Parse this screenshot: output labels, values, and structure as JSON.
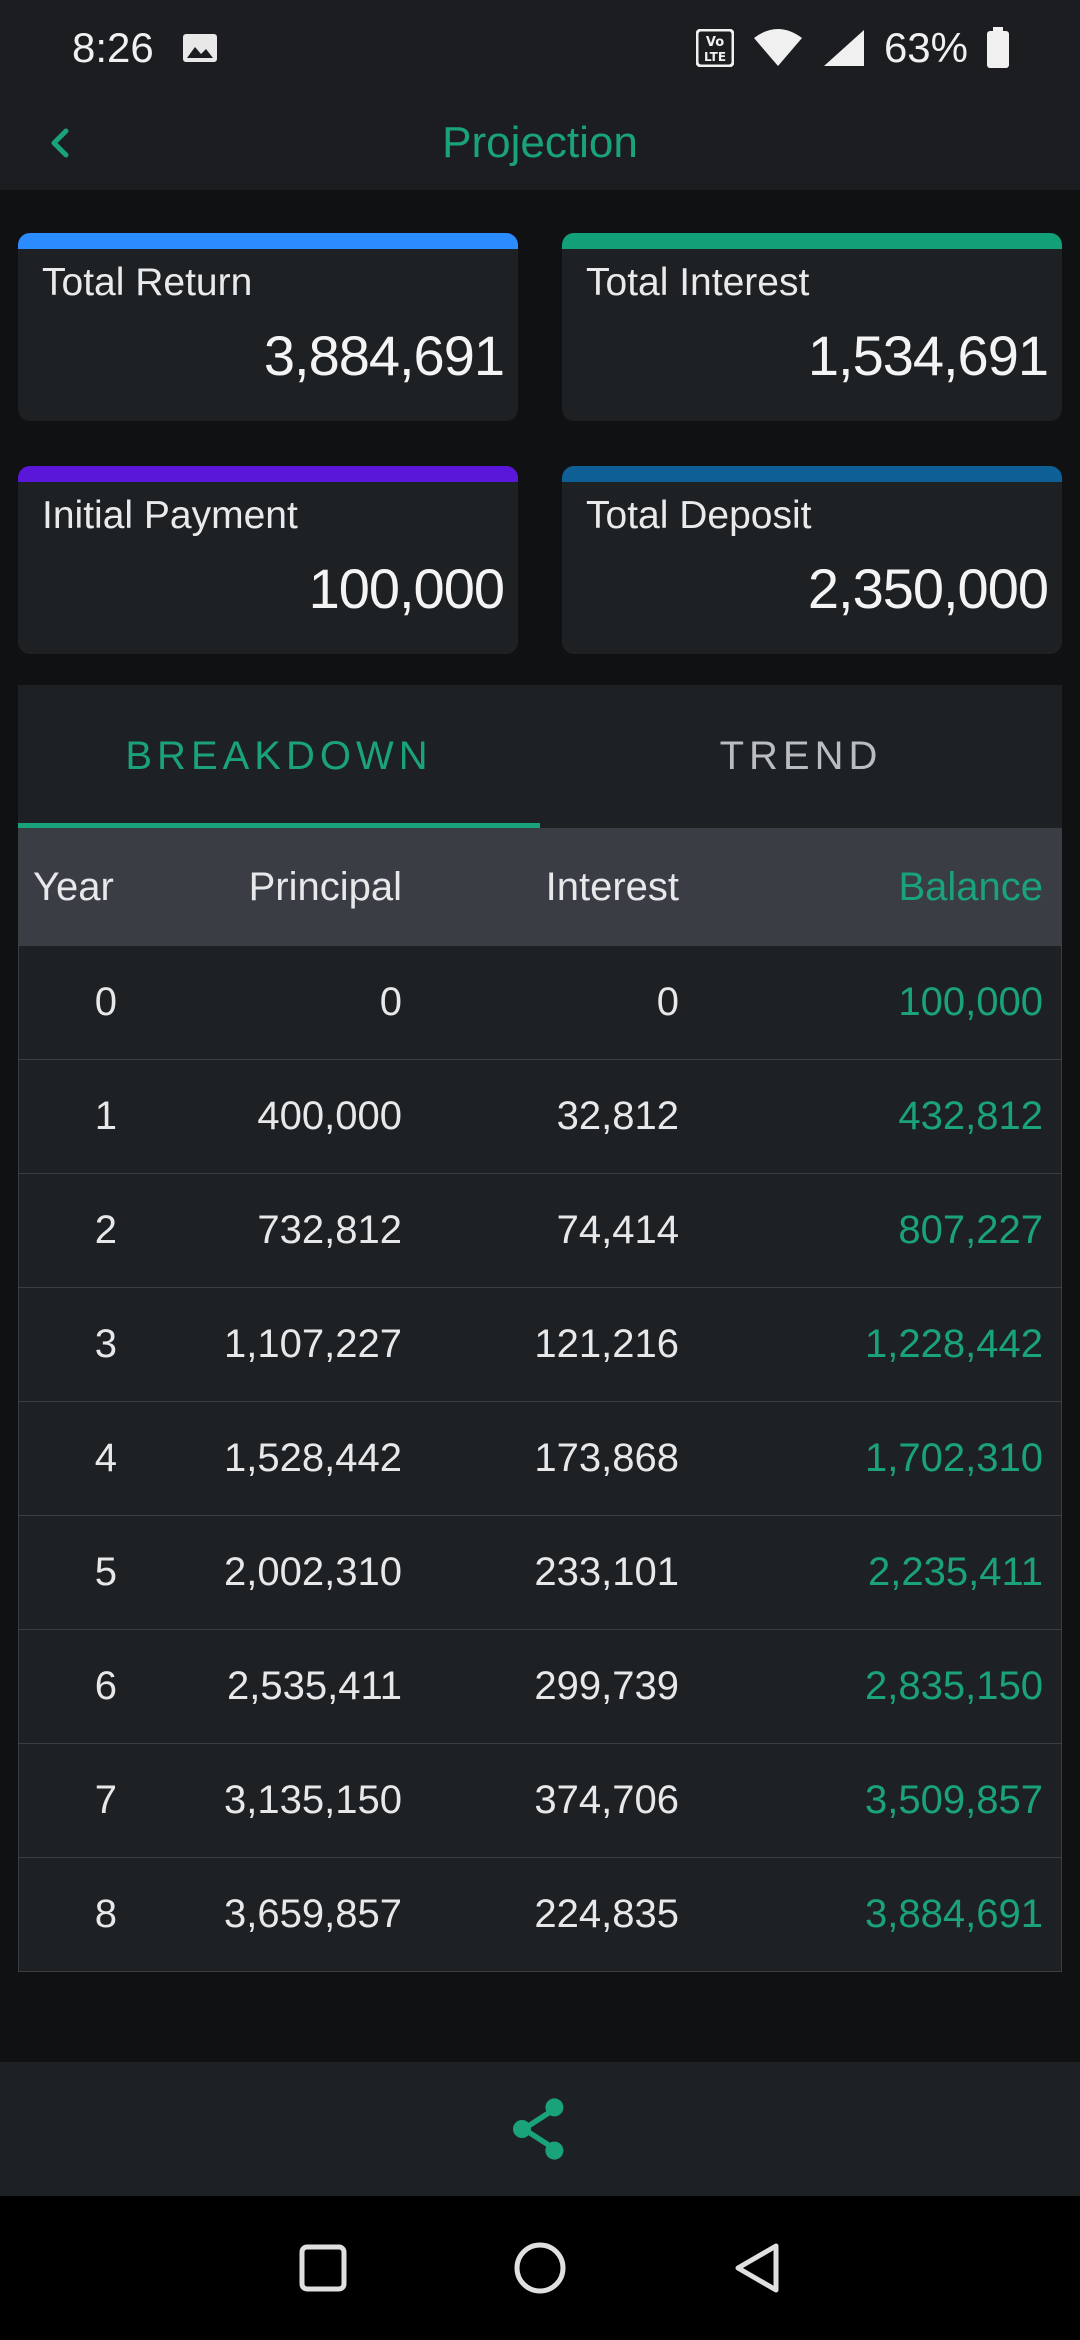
{
  "status": {
    "time": "8:26",
    "battery": "63%",
    "icons": [
      "image-icon",
      "volte-icon",
      "wifi-icon",
      "signal-icon",
      "battery-icon"
    ]
  },
  "header": {
    "title": "Projection",
    "back_icon": "chevron-left-icon"
  },
  "cards": [
    {
      "label": "Total Return",
      "value": "3,884,691",
      "accent": "#2a8cff"
    },
    {
      "label": "Total Interest",
      "value": "1,534,691",
      "accent": "#12a079"
    },
    {
      "label": "Initial Payment",
      "value": "100,000",
      "accent": "#5a16d9"
    },
    {
      "label": "Total Deposit",
      "value": "2,350,000",
      "accent": "#0d5f96"
    }
  ],
  "tabs": [
    {
      "label": "BREAKDOWN",
      "active": true
    },
    {
      "label": "TREND",
      "active": false
    }
  ],
  "table": {
    "headers": {
      "year": "Year",
      "principal": "Principal",
      "interest": "Interest",
      "balance": "Balance"
    },
    "rows": [
      {
        "year": "0",
        "principal": "0",
        "interest": "0",
        "balance": "100,000"
      },
      {
        "year": "1",
        "principal": "400,000",
        "interest": "32,812",
        "balance": "432,812"
      },
      {
        "year": "2",
        "principal": "732,812",
        "interest": "74,414",
        "balance": "807,227"
      },
      {
        "year": "3",
        "principal": "1,107,227",
        "interest": "121,216",
        "balance": "1,228,442"
      },
      {
        "year": "4",
        "principal": "1,528,442",
        "interest": "173,868",
        "balance": "1,702,310"
      },
      {
        "year": "5",
        "principal": "2,002,310",
        "interest": "233,101",
        "balance": "2,235,411"
      },
      {
        "year": "6",
        "principal": "2,535,411",
        "interest": "299,739",
        "balance": "2,835,150"
      },
      {
        "year": "7",
        "principal": "3,135,150",
        "interest": "374,706",
        "balance": "3,509,857"
      },
      {
        "year": "8",
        "principal": "3,659,857",
        "interest": "224,835",
        "balance": "3,884,691"
      }
    ]
  },
  "bottom": {
    "share_icon": "share-icon"
  },
  "colors": {
    "accent": "#1aa37a",
    "background": "#0f1113",
    "surface": "#1e2124"
  }
}
